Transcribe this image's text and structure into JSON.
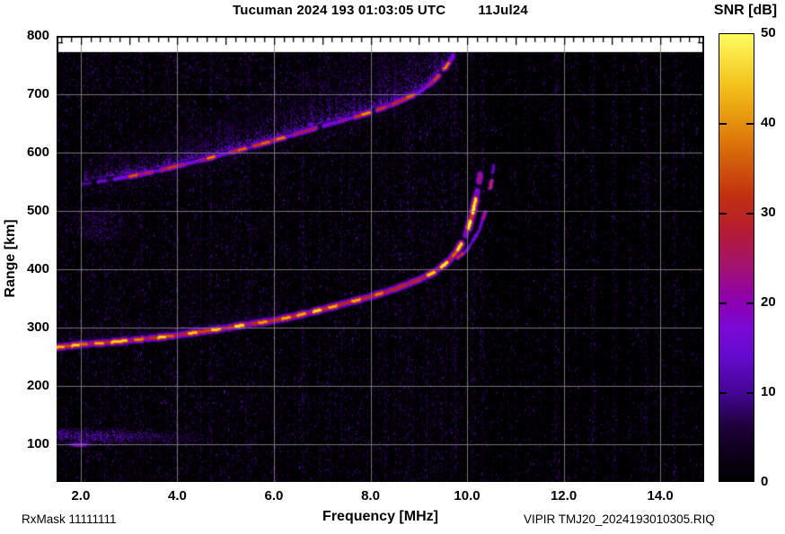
{
  "header": {
    "title": "Tucuman 2024 193 01:03:05 UTC",
    "date": "11Jul24"
  },
  "colorbar": {
    "title": "SNR [dB]",
    "min_db": 0,
    "max_db": 50,
    "ticks": [
      50,
      40,
      30,
      20,
      10,
      0
    ],
    "tick_labels": [
      "50",
      "40",
      "30",
      "20",
      "10",
      "0"
    ]
  },
  "axes": {
    "x": {
      "label": "Frequency [MHz]",
      "min": 1.5,
      "max": 14.9,
      "ticks": [
        2,
        4,
        6,
        8,
        10,
        12,
        14
      ],
      "tick_labels": [
        "2.0",
        "4.0",
        "6.0",
        "8.0",
        "10.0",
        "12.0",
        "14.0"
      ],
      "minor_tick_step": 0.2
    },
    "y": {
      "label": "Range [km]",
      "min": 35,
      "max": 800,
      "ticks": [
        100,
        200,
        300,
        400,
        500,
        600,
        700,
        800
      ],
      "tick_labels": [
        "100",
        "200",
        "300",
        "400",
        "500",
        "600",
        "700",
        "800"
      ],
      "minor_tick_step": 20
    }
  },
  "footer": {
    "left": "RxMask 11111111",
    "right": "VIPIR  TMJ20_2024193010305.RIQ"
  },
  "chart_data": {
    "type": "heatmap",
    "title": "Tucuman 2024 193 01:03:05 UTC 11Jul24",
    "xlabel": "Frequency [MHz]",
    "ylabel": "Range [km]",
    "xlim": [
      1.5,
      14.9
    ],
    "ylim": [
      35,
      800
    ],
    "value_label": "SNR [dB]",
    "value_range": [
      0,
      50
    ],
    "grid": true,
    "background_color": "#000000",
    "colormap_stops": [
      [
        0,
        0,
        0,
        0
      ],
      [
        6,
        28,
        0,
        55
      ],
      [
        10,
        70,
        5,
        150
      ],
      [
        14,
        100,
        10,
        205
      ],
      [
        17,
        122,
        10,
        215
      ],
      [
        20,
        140,
        0,
        178
      ],
      [
        24,
        163,
        18,
        112
      ],
      [
        28,
        180,
        28,
        48
      ],
      [
        32,
        194,
        48,
        16
      ],
      [
        38,
        220,
        118,
        8
      ],
      [
        44,
        243,
        192,
        24
      ],
      [
        50,
        255,
        252,
        96
      ]
    ],
    "critical_frequency_asymptote_mhz": 10.3,
    "noise_streak_freqs_mhz": [
      10.12,
      10.32,
      11.85,
      12.6,
      13.05,
      13.7,
      14.3
    ],
    "series": [
      {
        "id": "F1",
        "name": "F-region echo, 1st hop (O-mode)",
        "peak_snr_db": 42,
        "points": [
          [
            1.5,
            266
          ],
          [
            2.0,
            271
          ],
          [
            2.5,
            274
          ],
          [
            3.0,
            278
          ],
          [
            3.5,
            282
          ],
          [
            4.0,
            287
          ],
          [
            4.5,
            293
          ],
          [
            5.0,
            299
          ],
          [
            5.5,
            306
          ],
          [
            6.0,
            312
          ],
          [
            6.5,
            321
          ],
          [
            7.0,
            331
          ],
          [
            7.5,
            342
          ],
          [
            8.0,
            353
          ],
          [
            8.5,
            366
          ],
          [
            9.0,
            382
          ],
          [
            9.3,
            394
          ],
          [
            9.6,
            412
          ],
          [
            9.8,
            432
          ],
          [
            9.95,
            455
          ],
          [
            10.08,
            485
          ],
          [
            10.18,
            520
          ],
          [
            10.26,
            556
          ],
          [
            10.3,
            582
          ]
        ]
      },
      {
        "id": "F1X",
        "name": "F-region echo, 1st hop (X-mode cusp)",
        "peak_snr_db": 26,
        "points": [
          [
            9.4,
            398
          ],
          [
            9.7,
            412
          ],
          [
            10.0,
            433
          ],
          [
            10.25,
            466
          ],
          [
            10.4,
            505
          ],
          [
            10.5,
            548
          ],
          [
            10.56,
            582
          ],
          [
            10.6,
            600
          ]
        ]
      },
      {
        "id": "F2",
        "name": "F-region echo, 2nd hop",
        "peak_snr_db": 35,
        "points": [
          [
            2.05,
            546
          ],
          [
            2.5,
            552
          ],
          [
            3.0,
            559
          ],
          [
            3.5,
            567
          ],
          [
            4.0,
            577
          ],
          [
            4.5,
            587
          ],
          [
            5.0,
            598
          ],
          [
            5.5,
            609
          ],
          [
            6.0,
            621
          ],
          [
            6.5,
            633
          ],
          [
            7.0,
            645
          ],
          [
            7.5,
            657
          ],
          [
            8.0,
            669
          ],
          [
            8.5,
            684
          ],
          [
            9.0,
            703
          ],
          [
            9.3,
            722
          ],
          [
            9.5,
            740
          ],
          [
            9.65,
            757
          ],
          [
            9.72,
            766
          ]
        ]
      },
      {
        "id": "E",
        "name": "E-region echo",
        "peak_snr_db": 30,
        "points": [
          [
            1.5,
            113
          ],
          [
            2.0,
            111
          ],
          [
            3.0,
            110
          ],
          [
            4.7,
            108
          ]
        ]
      },
      {
        "id": "patch",
        "name": "weak mid-range scatter",
        "peak_snr_db": 10,
        "points": [
          [
            1.55,
            482
          ],
          [
            2.4,
            478
          ],
          [
            3.4,
            475
          ]
        ]
      },
      {
        "id": "F2spread",
        "name": "diffuse spread above 2nd hop",
        "peak_snr_db": 12,
        "points": [
          [
            2.0,
            565
          ],
          [
            9.7,
            790
          ]
        ]
      },
      {
        "id": "F1spread",
        "name": "diffuse spread above 1st hop",
        "peak_snr_db": 9,
        "points": [
          [
            1.5,
            285
          ],
          [
            6.2,
            330
          ]
        ]
      }
    ]
  }
}
